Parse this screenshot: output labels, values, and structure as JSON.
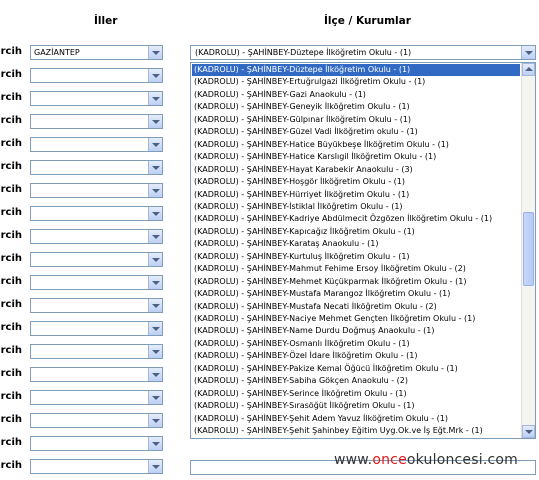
{
  "headers": {
    "iller": "İller",
    "ilce": "İlçe / Kurumlar"
  },
  "tercih_label": "Tercih",
  "provinces": {
    "selected": "GAZİANTEP",
    "count_rows": 19
  },
  "kurum_select": {
    "value": "(KADROLU) - ŞAHİNBEY-Düztepe İlköğretim Okulu - (1)"
  },
  "kurum_options": [
    "(KADROLU) - ŞAHİNBEY-Düztepe İlköğretim Okulu - (1)",
    "(KADROLU) - ŞAHİNBEY-Ertuğrulgazi İlköğretim Okulu - (1)",
    "(KADROLU) - ŞAHİNBEY-Gazi Anaokulu - (1)",
    "(KADROLU) - ŞAHİNBEY-Geneyik İlköğretim Okulu - (1)",
    "(KADROLU) - ŞAHİNBEY-Gülpınar İlköğretim Okulu - (1)",
    "(KADROLU) - ŞAHİNBEY-Güzel Vadi İlköğretim okulu - (1)",
    "(KADROLU) - ŞAHİNBEY-Hatice Büyükbeşe İlköğretim Okulu - (1)",
    "(KADROLU) - ŞAHİNBEY-Hatice Karslıgil İlköğretim Okulu - (1)",
    "(KADROLU) - ŞAHİNBEY-Hayat Karabekir Anaokulu - (3)",
    "(KADROLU) - ŞAHİNBEY-Hoşgör İlköğretim Okulu - (1)",
    "(KADROLU) - ŞAHİNBEY-Hürriyet İlköğretim Okulu - (1)",
    "(KADROLU) - ŞAHİNBEY-İstiklal İlköğretim Okulu - (1)",
    "(KADROLU) - ŞAHİNBEY-Kadriye Abdülmecit Özgözen İlköğretim Okulu - (1)",
    "(KADROLU) - ŞAHİNBEY-Kapıcağız İlköğretim Okulu - (1)",
    "(KADROLU) - ŞAHİNBEY-Karataş Anaokulu - (1)",
    "(KADROLU) - ŞAHİNBEY-Kurtuluş İlköğretim Okulu - (1)",
    "(KADROLU) - ŞAHİNBEY-Mahmut Fehime Ersoy İlköğretim Okulu - (2)",
    "(KADROLU) - ŞAHİNBEY-Mehmet Küçükparmak İlköğretim Okulu - (1)",
    "(KADROLU) - ŞAHİNBEY-Mustafa Marangoz İlköğretim Okulu - (1)",
    "(KADROLU) - ŞAHİNBEY-Mustafa Necati İlköğretim Okulu - (2)",
    "(KADROLU) - ŞAHİNBEY-Naciye Mehmet Gençten İlköğretim Okulu - (1)",
    "(KADROLU) - ŞAHİNBEY-Name Durdu Doğmuş Anaokulu - (1)",
    "(KADROLU) - ŞAHİNBEY-Osmanlı İlköğretim Okulu - (1)",
    "(KADROLU) - ŞAHİNBEY-Özel İdare İlköğretim Okulu - (1)",
    "(KADROLU) - ŞAHİNBEY-Pakize Kemal Öğücü İlköğretim Okulu - (1)",
    "(KADROLU) - ŞAHİNBEY-Sabiha Gökçen Anaokulu - (2)",
    "(KADROLU) - ŞAHİNBEY-Serince İlköğretim Okulu - (1)",
    "(KADROLU) - ŞAHİNBEY-Sırasöğüt İlköğretim Okulu - (1)",
    "(KADROLU) - ŞAHİNBEY-Şehit Adem Yavuz İlköğretim Okulu - (1)",
    "(KADROLU) - ŞAHİNBEY-Şehit Şahinbey Eğitim Uyg.Ok.ve İş Eğt.Mrk - (1)"
  ],
  "selected_option_index": 0,
  "watermark": {
    "prefix": "www.",
    "highlight": "once",
    "suffix": "okuloncesi.com"
  }
}
